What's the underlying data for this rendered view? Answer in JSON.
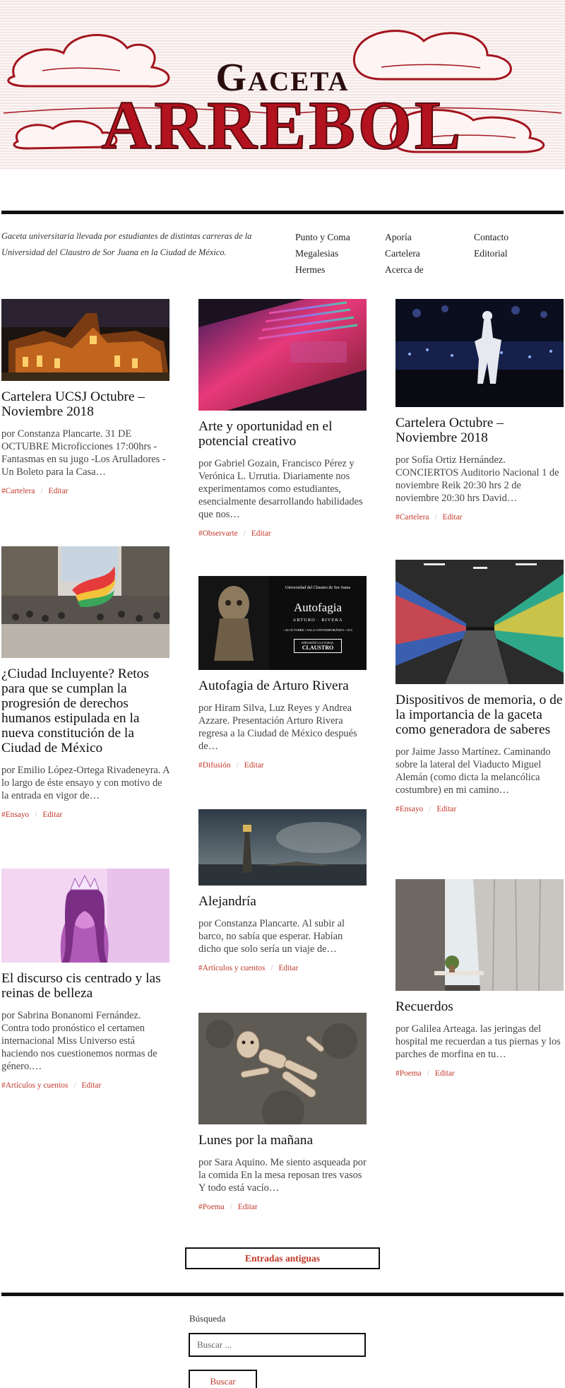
{
  "site": {
    "title_line1": "Gaceta",
    "title_line2": "Arrebol",
    "tagline": "Gaceta universitaria llevada por estudiantes de distintas carreras de la Universidad del Claustro de Sor Juana en la Ciudad de México."
  },
  "nav": {
    "col1": [
      "Punto y Coma",
      "Megalesias",
      "Hermes"
    ],
    "col2": [
      "Aporía",
      "Cartelera",
      "Acerca de"
    ],
    "col3": [
      "Contacto",
      "Editorial"
    ]
  },
  "posts": [
    {
      "title": "Cartelera UCSJ Octubre – Noviembre 2018",
      "excerpt": "por Constanza Plancarte.   31 DE OCTUBRE Microficciones  17:00hrs -Fantasmas en su jugo -Los Arulladores -Un Boleto para la Casa…",
      "category": "#Cartelera",
      "edit": "Editar",
      "image": "night-building-photo"
    },
    {
      "title": "Arte y oportunidad en el potencial creativo",
      "excerpt": "por Gabriel Gozain, Francisco Pérez y Verónica L. Urrutia.  Diariamente nos experimentamos como estudiantes, esencialmente desarrollando habilidades que nos…",
      "category": "#Observarte",
      "edit": "Editar",
      "image": "laptop-keyboard-photo"
    },
    {
      "title": "Cartelera Octubre – Noviembre 2018",
      "excerpt": "por Sofía Ortiz Hernández. CONCIERTOS Auditorio Nacional 1 de noviembre Reik 20:30 hrs 2 de noviembre 20:30 hrs David…",
      "category": "#Cartelera",
      "edit": "Editar",
      "image": "concert-stage-photo"
    },
    {
      "title": "¿Ciudad Incluyente? Retos para que se cumplan la progresión de derechos humanos estipulada en la nueva constitución de la Ciudad de México",
      "excerpt": "por Emilio López-Ortega Rivadeneyra.   A lo largo de éste ensayo y con motivo de la entrada en vigor de…",
      "category": "#Ensayo",
      "edit": "Editar",
      "image": "pride-march-photo"
    },
    {
      "title": "Autofagia de Arturo Rivera",
      "excerpt": "  por Hiram Silva, Luz Reyes y Andrea Azzare. Presentación Arturo Rivera regresa a la Ciudad de México después de…",
      "category": "#Difusión",
      "edit": "Editar",
      "image": "autofagia-poster",
      "poster": {
        "org": "Universidad del Claustro de Sor Juana",
        "title": "Autofagia",
        "artist": "ARTURO · RIVERA",
        "details": "• 26 OCTUBRE • SALA CONTEMPORÁNEA • 19 h",
        "badge_top": "DIFUSIÓN CULTURAL",
        "badge": "CLAUSTRO"
      }
    },
    {
      "title": "Dispositivos de memoria, o de la importancia de la gaceta como generadora de saberes",
      "excerpt": "por Jaime Jasso Martínez. Caminando sobre la lateral del Viaducto Miguel Alemán (como dicta la melancólica costumbre) en mi camino…",
      "category": "#Ensayo",
      "edit": "Editar",
      "image": "graffiti-tunnel-photo"
    },
    {
      "title": "Alejandría",
      "excerpt": "por Constanza Plancarte.   Al subir al barco, no sabía que esperar. Habían dicho que solo sería un viaje de…",
      "category": "#Artículos y cuentos",
      "edit": "Editar",
      "image": "lighthouse-painting"
    },
    {
      "title": "El discurso cis centrado y las reinas de belleza",
      "excerpt": "por Sabrina Bonanomi Fernández. Contra todo pronóstico el certamen internacional Miss Universo está haciendo nos cuestionemos normas de género.…",
      "category": "#Artículos y cuentos",
      "edit": "Editar",
      "image": "beauty-queen-photo"
    },
    {
      "title": "Recuerdos",
      "excerpt": "por Galilea Arteaga.   las jeringas del hospital me recuerdan a tus piernas y los parches de morfina en tu…",
      "category": "#Poema",
      "edit": "Editar",
      "image": "window-curtain-photo"
    },
    {
      "title": "Lunes por la mañana",
      "excerpt": "por Sara Aquino.   Me siento asqueada por la comida En la mesa reposan tres vasos Y todo está vacío…",
      "category": "#Poema",
      "edit": "Editar",
      "image": "broken-doll-photo"
    }
  ],
  "pagination": {
    "older_label": "Entradas antiguas"
  },
  "search": {
    "label": "Búsqueda",
    "placeholder": "Buscar ...",
    "button": "Buscar"
  },
  "colors": {
    "accent": "#c0392b",
    "masthead": "#b3121f",
    "rule": "#111111"
  }
}
